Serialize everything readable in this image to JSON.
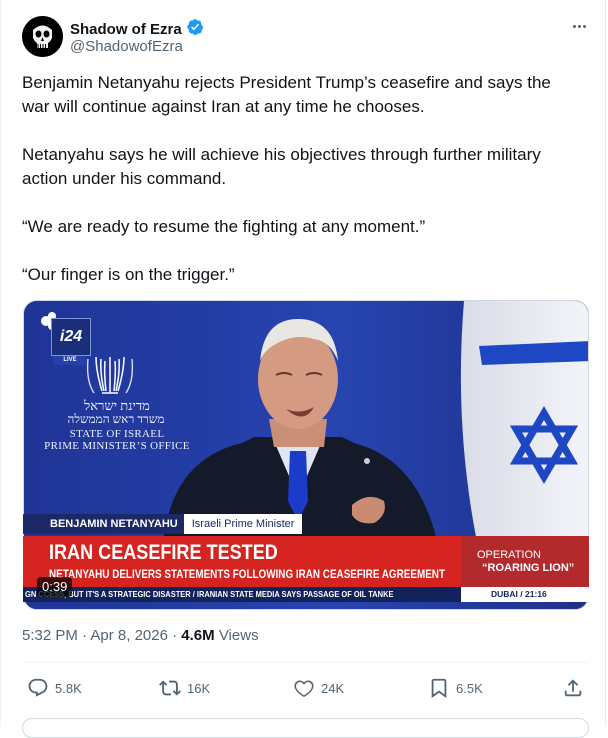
{
  "author": {
    "display_name": "Shadow of Ezra",
    "handle": "@ShadowofEzra",
    "verified": true,
    "verified_color": "#1d9bf0"
  },
  "post": {
    "paragraphs": [
      "Benjamin Netanyahu rejects President Trump’s ceasefire and says the war will continue against Iran at any time he chooses.",
      "Netanyahu says he will achieve his objectives through further military action under his command.",
      "“We are ready to resume the fighting at any moment.”",
      "“Our finger is on the trigger.”"
    ]
  },
  "video": {
    "channel_logo": "i24",
    "live_label": "LIVE",
    "seal_hebrew_1": "מדינת ישראל",
    "seal_hebrew_2": "משרד ראש הממשלה",
    "seal_english_1": "STATE OF ISRAEL",
    "seal_english_2": "PRIME MINISTER’S OFFICE",
    "speaker_name": "BENJAMIN NETANYAHU",
    "speaker_role": "Israeli Prime Minister",
    "headline": "IRAN CEASEFIRE TESTED",
    "subheadline": "NETANYAHU DELIVERS STATEMENTS FOLLOWING IRAN CEASEFIRE AGREEMENT",
    "ticker": "GN CCESS, BUT IT'S A STRATEGIC DISASTER  /  IRANIAN STATE MEDIA SAYS PASSAGE OF OIL TANKE",
    "operation_line1": "OPERATION",
    "operation_line2": "“ROARING LION”",
    "location_time": "DUBAI / 21:16",
    "duration": "0:39"
  },
  "meta": {
    "time": "5:32 PM",
    "date": "Apr 8, 2026",
    "views_count": "4.6M",
    "views_label": "Views"
  },
  "actions": {
    "replies": "5.8K",
    "reposts": "16K",
    "likes": "24K",
    "bookmarks": "6.5K"
  },
  "colors": {
    "text": "#0f1419",
    "secondary": "#536471",
    "breaking_red": "#d5231f",
    "navy": "#1b2a66"
  }
}
